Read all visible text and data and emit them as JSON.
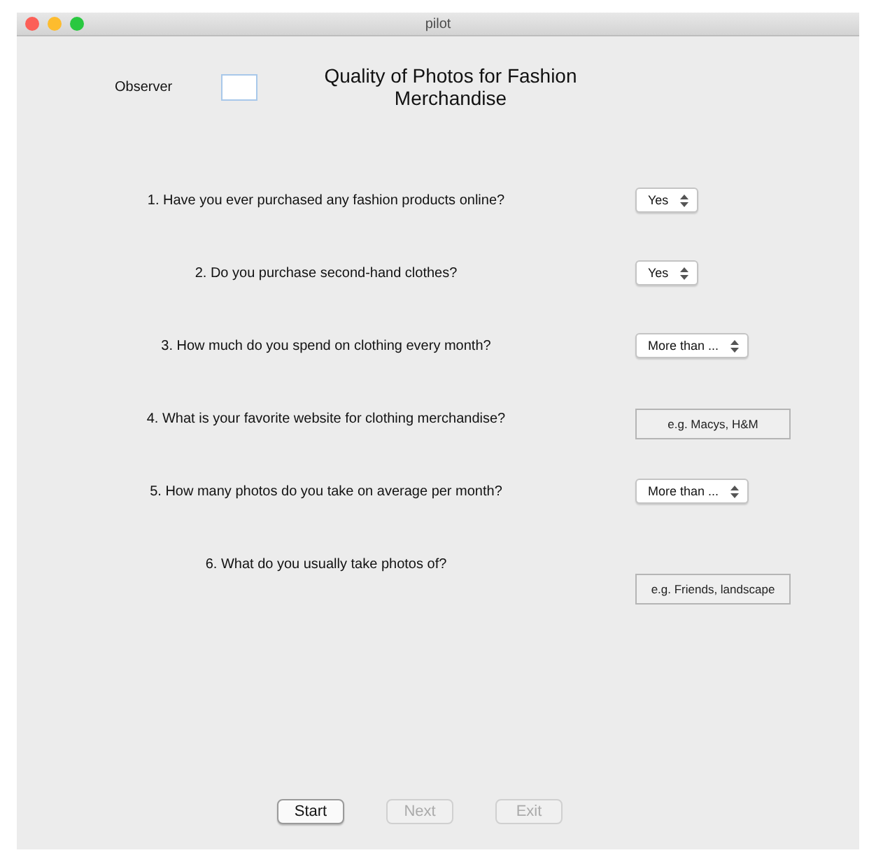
{
  "window": {
    "title": "pilot"
  },
  "observer": {
    "label": "Observer"
  },
  "heading": "Quality of Photos for Fashion Merchandise",
  "questions": [
    {
      "text": "1. Have you ever purchased any fashion products online?",
      "kind": "select",
      "value": "Yes"
    },
    {
      "text": "2. Do you purchase second-hand clothes?",
      "kind": "select",
      "value": "Yes"
    },
    {
      "text": "3. How much do you spend on clothing every month?",
      "kind": "select",
      "value": "More than ..."
    },
    {
      "text": "4. What is your favorite website for clothing merchandise?",
      "kind": "text",
      "placeholder": "e.g. Macys, H&M"
    },
    {
      "text": "5. How many photos do you take on average per month?",
      "kind": "select",
      "value": "More than ..."
    },
    {
      "text": "6. What do you usually take photos of?",
      "kind": "text_low",
      "placeholder": "e.g. Friends, landscape"
    }
  ],
  "buttons": [
    {
      "label": "Start",
      "disabled": false
    },
    {
      "label": "Next",
      "disabled": true
    },
    {
      "label": "Exit",
      "disabled": true
    }
  ]
}
